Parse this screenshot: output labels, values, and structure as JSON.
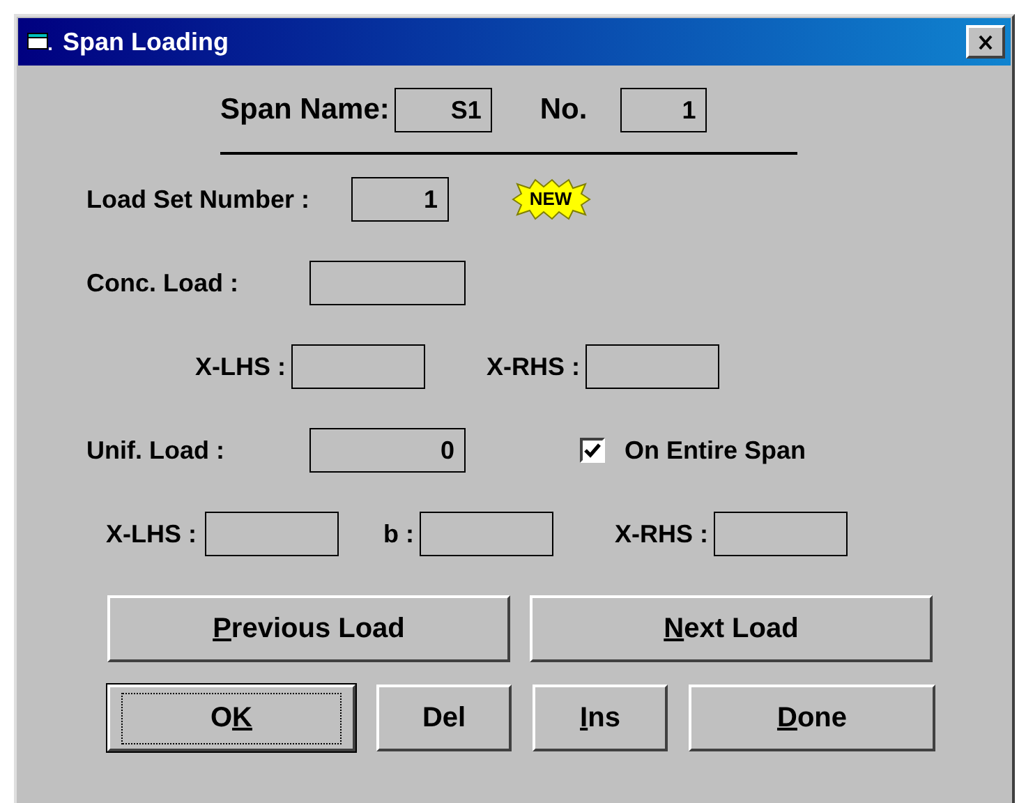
{
  "window": {
    "title": "Span Loading"
  },
  "header": {
    "span_name": {
      "label": "Span Name:",
      "value": "S1"
    },
    "number": {
      "label": "No.",
      "value": "1"
    }
  },
  "load_set": {
    "label": "Load Set Number :",
    "value": "1",
    "badge": "NEW"
  },
  "conc_load": {
    "label": "Conc. Load :"
  },
  "conc_positions": [
    {
      "label": "X-LHS :"
    },
    {
      "label": "X-RHS :"
    }
  ],
  "unif_load": {
    "label": "Unif. Load :",
    "value": "0"
  },
  "on_entire_span": {
    "label": "On Entire Span",
    "checked": true
  },
  "unif_positions": [
    {
      "label": "X-LHS :"
    },
    {
      "label": "b :"
    },
    {
      "label": "X-RHS :"
    }
  ],
  "nav_buttons": [
    {
      "key": "P",
      "after": "revious Load",
      "default": false
    },
    {
      "key": "N",
      "after": "ext Load",
      "default": false
    }
  ],
  "action_buttons": [
    {
      "before": "O",
      "key": "K",
      "default": true
    },
    {
      "before": "Del",
      "default": false
    },
    {
      "key": "I",
      "after": "ns",
      "default": false
    },
    {
      "key": "D",
      "after": "one",
      "default": false
    }
  ]
}
